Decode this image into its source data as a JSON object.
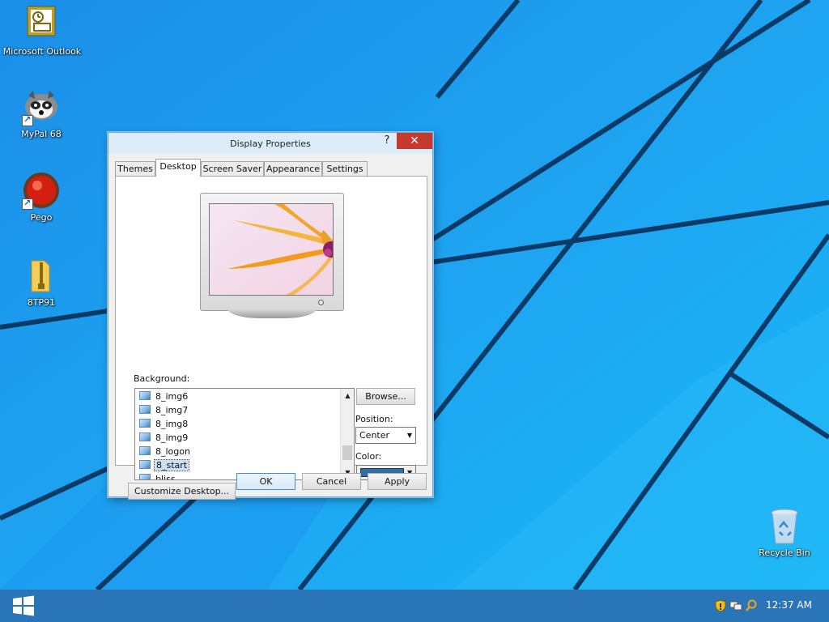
{
  "desktop": {
    "icons": [
      {
        "label": "Microsoft Outlook",
        "icon": "outlook-icon"
      },
      {
        "label": "MyPal 68",
        "icon": "mypal-icon"
      },
      {
        "label": "Pego",
        "icon": "pego-icon"
      },
      {
        "label": "8TP91",
        "icon": "zip-folder-icon"
      },
      {
        "label": "Recycle Bin",
        "icon": "recycle-bin-icon"
      }
    ]
  },
  "dialog": {
    "title": "Display Properties",
    "help_glyph": "?",
    "close_glyph": "✕",
    "tabs": [
      {
        "label": "Themes"
      },
      {
        "label": "Desktop",
        "active": true
      },
      {
        "label": "Screen Saver"
      },
      {
        "label": "Appearance"
      },
      {
        "label": "Settings"
      }
    ],
    "background_label": "Background:",
    "background_items": [
      {
        "label": "8_img6"
      },
      {
        "label": "8_img7"
      },
      {
        "label": "8_img8"
      },
      {
        "label": "8_img9"
      },
      {
        "label": "8_logon"
      },
      {
        "label": "8_start",
        "selected": true
      },
      {
        "label": "bliss"
      }
    ],
    "browse_label": "Browse...",
    "position_label": "Position:",
    "position_value": "Center",
    "color_label": "Color:",
    "color_value": "#2f6fa7",
    "customize_label": "Customize Desktop...",
    "ok_label": "OK",
    "cancel_label": "Cancel",
    "apply_label": "Apply"
  },
  "taskbar": {
    "clock": "12:37 AM",
    "tray_icons": [
      "shield-icon",
      "network-icon",
      "search-icon"
    ]
  },
  "colors": {
    "wallpaper_blue": "#1a8fe6",
    "taskbar": "#2a75b8",
    "close_button": "#c7392c"
  }
}
